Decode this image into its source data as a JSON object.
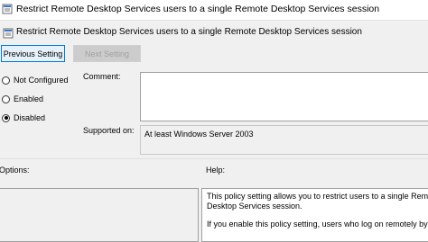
{
  "window": {
    "title": "Restrict Remote Desktop Services users to a single Remote Desktop Services session"
  },
  "header": {
    "policy_name": "Restrict Remote Desktop Services users to a single Remote Desktop Services session"
  },
  "nav": {
    "previous_label": "Previous Setting",
    "next_label": "Next Setting"
  },
  "state": {
    "options": [
      {
        "label": "Not Configured",
        "checked": false
      },
      {
        "label": "Enabled",
        "checked": false
      },
      {
        "label": "Disabled",
        "checked": true
      }
    ]
  },
  "comment": {
    "label": "Comment:",
    "value": ""
  },
  "supported_on": {
    "label": "Supported on:",
    "value": "At least Windows Server 2003"
  },
  "options_section": {
    "label": "Options:"
  },
  "help_section": {
    "label": "Help:",
    "lines": [
      "This policy setting allows you to restrict users to a single Remote",
      "Desktop Services session.",
      "If you enable this policy setting, users who log on remotely by"
    ]
  },
  "colors": {
    "titlebar": "#ffffff",
    "dialog_bg": "#f0f0f0",
    "accent": "#0078d7"
  },
  "icons": [
    "policy-icon",
    "policy-icon"
  ]
}
